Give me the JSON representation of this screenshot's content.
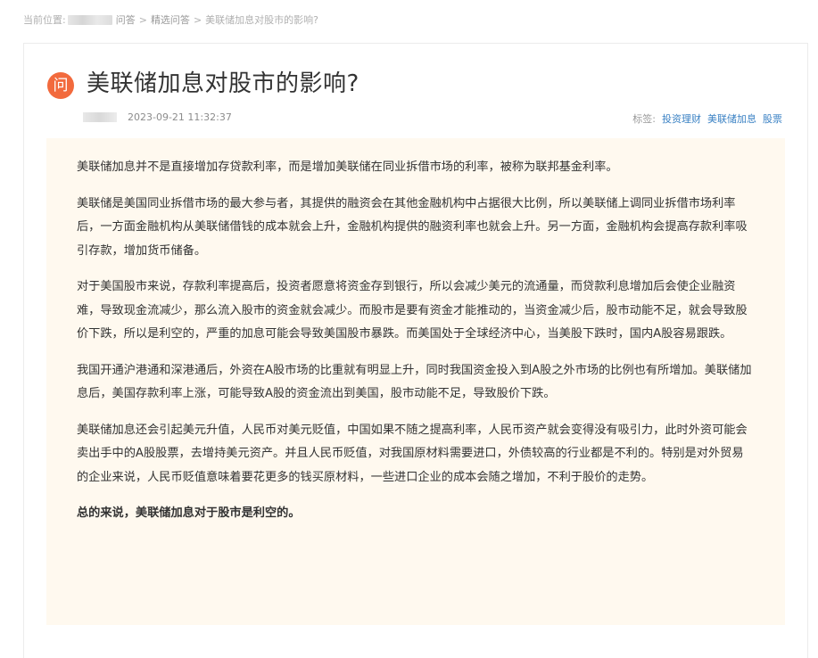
{
  "breadcrumb": {
    "prefix": "当前位置:",
    "items": [
      "问答",
      "精选问答"
    ],
    "current": "美联储加息对股市的影响?"
  },
  "question": {
    "icon_text": "问",
    "title": "美联储加息对股市的影响?",
    "datetime": "2023-09-21 11:32:37",
    "tags_label": "标签:",
    "tags": [
      "投资理财",
      "美联储加息",
      "股票"
    ]
  },
  "answer": {
    "paragraphs": [
      "美联储加息并不是直接增加存贷款利率，而是增加美联储在同业拆借市场的利率，被称为联邦基金利率。",
      "美联储是美国同业拆借市场的最大参与者，其提供的融资会在其他金融机构中占据很大比例，所以美联储上调同业拆借市场利率后，一方面金融机构从美联储借钱的成本就会上升，金融机构提供的融资利率也就会上升。另一方面，金融机构会提高存款利率吸引存款，增加货币储备。",
      "对于美国股市来说，存款利率提高后，投资者愿意将资金存到银行，所以会减少美元的流通量，而贷款利息增加后会使企业融资难，导致现金流减少，那么流入股市的资金就会减少。而股市是要有资金才能推动的，当资金减少后，股市动能不足，就会导致股价下跌，所以是利空的，严重的加息可能会导致美国股市暴跌。而美国处于全球经济中心，当美股下跌时，国内A股容易跟跌。",
      "我国开通沪港通和深港通后，外资在A股市场的比重就有明显上升，同时我国资金投入到A股之外市场的比例也有所增加。美联储加息后，美国存款利率上涨，可能导致A股的资金流出到美国，股市动能不足，导致股价下跌。",
      "美联储加息还会引起美元升值，人民币对美元贬值，中国如果不随之提高利率，人民币资产就会变得没有吸引力，此时外资可能会卖出手中的A股股票，去增持美元资产。并且人民币贬值，对我国原材料需要进口，外债较高的行业都是不利的。特别是对外贸易的企业来说，人民币贬值意味着要花更多的钱买原材料，一些进口企业的成本会随之增加，不利于股价的走势。"
    ],
    "conclusion": "总的来说，美联储加息对于股市是利空的。"
  },
  "colors": {
    "accent": "#f26a3d",
    "tag_link": "#3b82c4",
    "answer_bg": "#fff9ef"
  }
}
